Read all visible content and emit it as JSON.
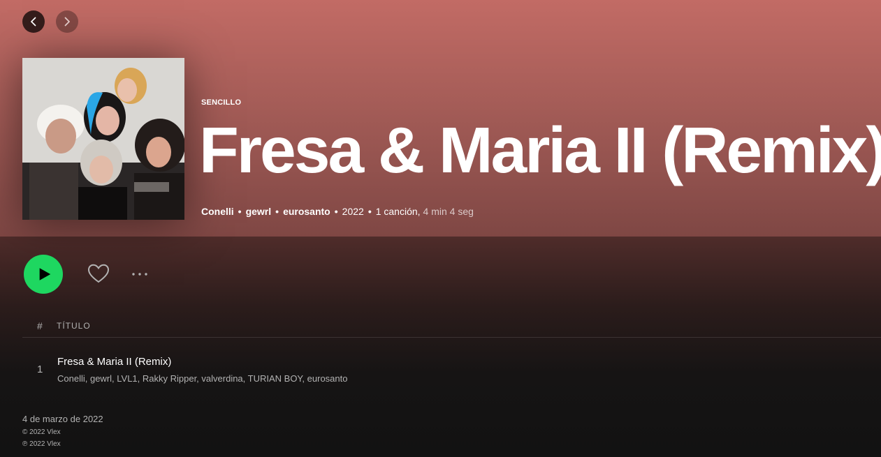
{
  "nav": {
    "back_icon": "chevron-left-icon",
    "forward_icon": "chevron-right-icon"
  },
  "album": {
    "type_label": "SENCILLO",
    "title": "Fresa & Maria II (Remix)",
    "artists": [
      "Conelli",
      "gewrl",
      "eurosanto"
    ],
    "separator": "•",
    "year": "2022",
    "song_count": "1 canción,",
    "duration": "4 min 4 seg"
  },
  "actions": {
    "play_icon": "play-icon",
    "like_icon": "heart-icon",
    "more_icon": "more-options-icon"
  },
  "table": {
    "header": {
      "number": "#",
      "title": "TÍTULO"
    },
    "tracks": [
      {
        "number": "1",
        "title": "Fresa & Maria II (Remix)",
        "artists": "Conelli, gewrl, LVL1, Rakky Ripper, valverdina, TURIAN BOY, eurosanto"
      }
    ]
  },
  "footer": {
    "release_date": "4 de marzo de 2022",
    "copyright": "© 2022 Vlex",
    "phonogram": "℗ 2022 Vlex"
  },
  "colors": {
    "hero_top": "#c26b65",
    "accent_green": "#1ed760",
    "background": "#121212"
  }
}
